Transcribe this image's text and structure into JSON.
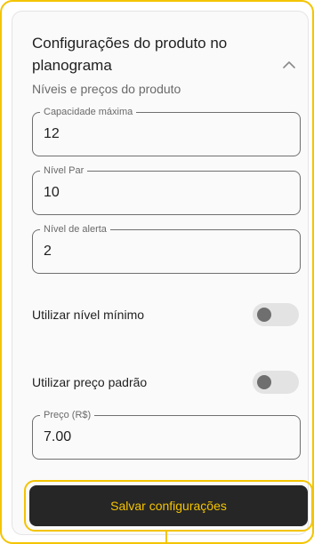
{
  "section": {
    "title": "Configurações do produto no planograma",
    "subtitle": "Níveis e preços do produto",
    "collapse_icon": "chevron-up-icon"
  },
  "fields": [
    {
      "label": "Capacidade máxima",
      "value": "12"
    },
    {
      "label": "Nível Par",
      "value": "10"
    },
    {
      "label": "Nível de alerta",
      "value": "2"
    }
  ],
  "toggles": [
    {
      "label": "Utilizar nível mínimo",
      "on": false
    },
    {
      "label": "Utilizar preço padrão",
      "on": false
    }
  ],
  "price_field": {
    "label": "Preço (R$)",
    "value": "7.00"
  },
  "actions": {
    "save_label": "Salvar configurações"
  },
  "colors": {
    "accent": "#f4c400",
    "button_bg": "#262626",
    "button_text": "#f5c400",
    "toggle_track": "#e3e3e3",
    "toggle_knob": "#6f6f6f"
  }
}
